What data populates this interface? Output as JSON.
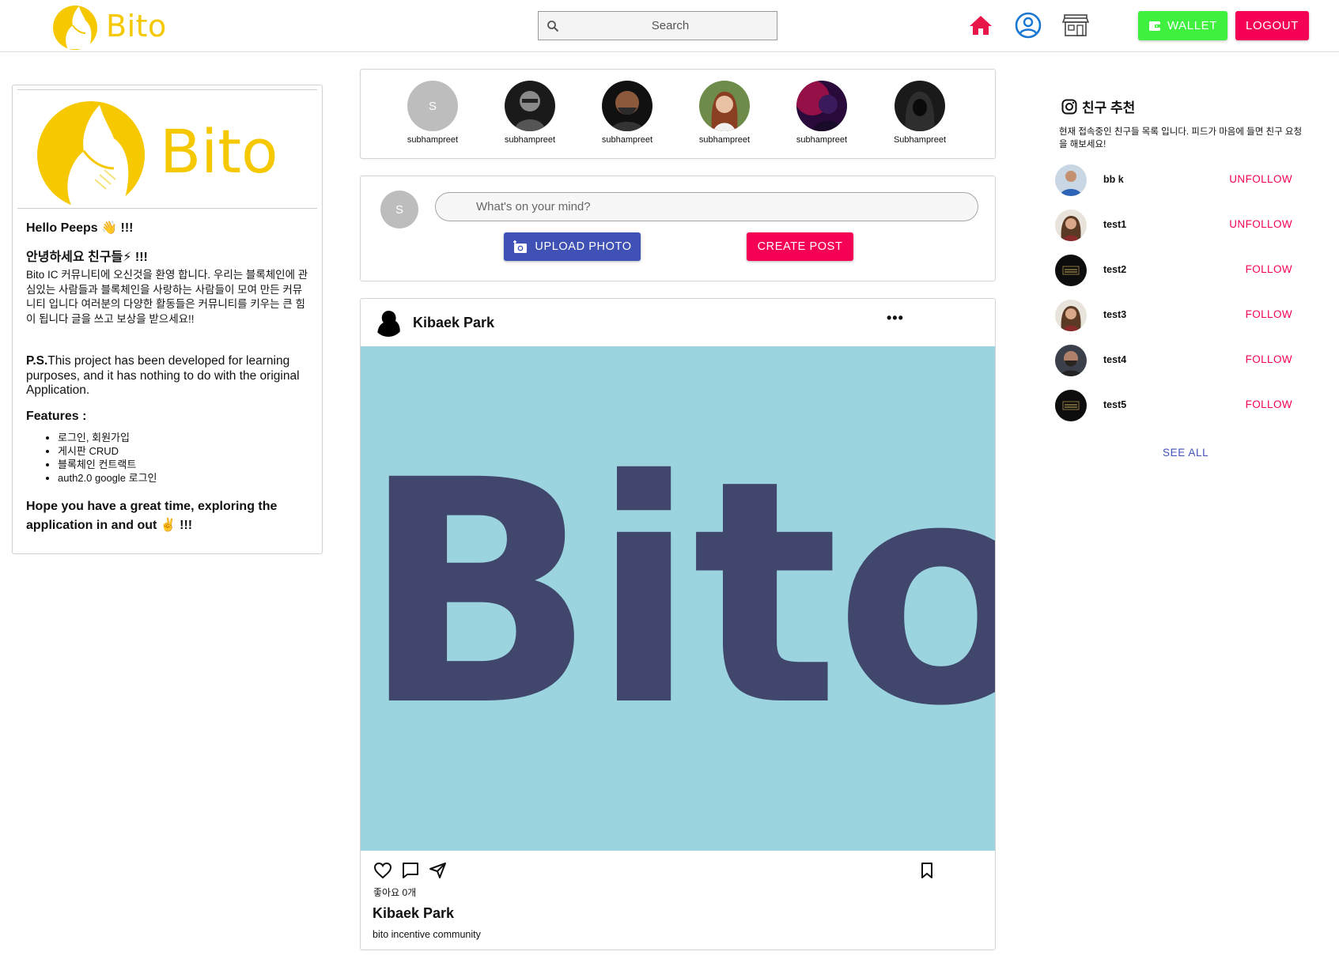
{
  "header": {
    "brand": "Bito",
    "search_placeholder": "Search",
    "wallet_label": "WALLET",
    "logout_label": "LOGOUT",
    "icons": [
      "home-icon",
      "account-circle-icon",
      "store-icon"
    ]
  },
  "intro": {
    "brand": "Bito",
    "greeting_en": "Hello Peeps 👋 !!!",
    "greeting_ko": "안녕하세요 친구들⚡ !!!",
    "welcome": "Bito IC 커뮤니티에 오신것을 환영 합니다. 우리는 블록체인에 관심있는 사람들과 블록체인을 사랑하는 사람들이 모여 만든 커뮤니티 입니다 여러분의 다양한 활동들은 커뮤니티를 키우는 큰 힘이 됩니다 글을 쓰고 보상을 받으세요!!",
    "ps_bold": "P.S.",
    "ps_text": "This project has been developed for learning purposes, and it has nothing to do with the original Application.",
    "features_title": "Features :",
    "features": [
      "로그인, 회원가입",
      "게시판 CRUD",
      "블록체인 컨트랙트",
      "auth2.0 google 로그인"
    ],
    "closing": "Hope you have a great time, exploring the application in and out ✌️ !!!"
  },
  "stories": [
    {
      "name": "subhampreet",
      "avatar": "letter-s"
    },
    {
      "name": "subhampreet",
      "avatar": "photo"
    },
    {
      "name": "subhampreet",
      "avatar": "photo"
    },
    {
      "name": "subhampreet",
      "avatar": "photo"
    },
    {
      "name": "subhampreet",
      "avatar": "photo"
    },
    {
      "name": "Subhampreet",
      "avatar": "photo"
    }
  ],
  "story_letter": "S",
  "composer": {
    "avatar_letter": "S",
    "placeholder": "What's on your mind?",
    "upload_label": "UPLOAD PHOTO",
    "create_label": "CREATE POST"
  },
  "post": {
    "author": "Kibaek Park",
    "more": "•••",
    "image_text": "Bito",
    "likes": "좋아요 0개",
    "caption_author": "Kibaek Park",
    "caption": "bito incentive community"
  },
  "suggestions": {
    "title": "친구 추천",
    "description": "현재 접속중인 친구들 목록 입니다. 피드가 마음에 들면 친구 요청을 해보세요!",
    "users": [
      {
        "name": "bb k",
        "action": "UNFOLLOW"
      },
      {
        "name": "test1",
        "action": "UNFOLLOW"
      },
      {
        "name": "test2",
        "action": "FOLLOW"
      },
      {
        "name": "test3",
        "action": "FOLLOW"
      },
      {
        "name": "test4",
        "action": "FOLLOW"
      },
      {
        "name": "test5",
        "action": "FOLLOW"
      }
    ],
    "see_all": "SEE ALL"
  },
  "colors": {
    "brand_yellow": "#f5c800",
    "wallet_green": "#3ff03f",
    "accent_pink": "#f50057",
    "primary_indigo": "#3f51b5",
    "home_red": "#e8174a",
    "post_image_bg": "#9bd4df",
    "post_image_text": "#40466c"
  }
}
